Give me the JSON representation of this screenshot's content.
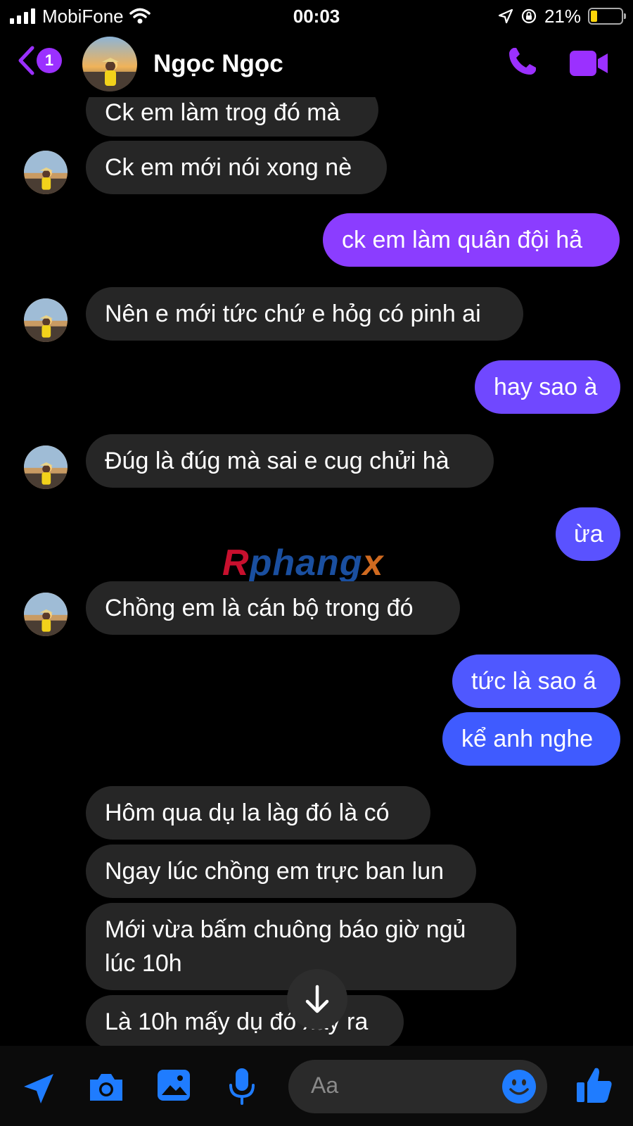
{
  "status_bar": {
    "carrier": "MobiFone",
    "time": "00:03",
    "battery_percent": "21%",
    "battery_level": 0.21
  },
  "header": {
    "back_badge": "1",
    "contact_name": "Ngọc Ngọc",
    "accent_color": "#9b30ff"
  },
  "messages": [
    {
      "from": "them",
      "text": "Ck em làm trog đó mà"
    },
    {
      "from": "them",
      "text": "Ck em mới nói xong nè"
    },
    {
      "from": "me",
      "text": "ck em làm quân đội hả"
    },
    {
      "from": "them",
      "text": "Nên e mới tức chứ e hỏg có pinh ai"
    },
    {
      "from": "me",
      "text": "hay sao à"
    },
    {
      "from": "them",
      "text": "Đúg là đúg mà sai e cug chửi hà"
    },
    {
      "from": "me",
      "text": "ừa"
    },
    {
      "from": "them",
      "text": "Chồng em là cán bộ trong đó"
    },
    {
      "from": "me",
      "text": "tức là sao á"
    },
    {
      "from": "me",
      "text": "kể anh nghe"
    },
    {
      "from": "them",
      "text": "Hôm qua dụ la làg đó là có"
    },
    {
      "from": "them",
      "text": "Ngay lúc chồng em trực ban lun"
    },
    {
      "from": "them",
      "text": "Mới vừa bấm chuông báo giờ ngủ"
    },
    {
      "from": "them",
      "text": "lúc 10h"
    },
    {
      "from": "them",
      "text": "Là 10h mấy dụ đó xảy ra"
    }
  ],
  "watermark": {
    "part1": "R",
    "part2": "phang",
    "part3": "x"
  },
  "composer": {
    "placeholder": "Aa",
    "icons": [
      "location-arrow-icon",
      "camera-icon",
      "photo-icon",
      "microphone-icon",
      "emoji-icon",
      "thumbs-up-icon"
    ]
  },
  "colors": {
    "incoming_bubble": "#262626",
    "outgoing_top": "#8b3dff",
    "outgoing_bottom": "#3f5bff",
    "icon_blue": "#1f7cff"
  }
}
